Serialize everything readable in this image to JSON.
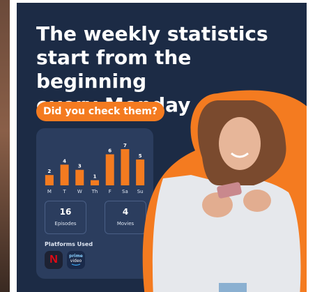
{
  "headline": "The weekly statistics\nstart from the beginning\nevery Monday",
  "cta_label": "Did you check them?",
  "chart_data": {
    "type": "bar",
    "categories": [
      "M",
      "T",
      "W",
      "Th",
      "F",
      "Sa",
      "Su"
    ],
    "values": [
      2,
      4,
      3,
      1,
      6,
      7,
      5
    ],
    "ylim": [
      0,
      7
    ],
    "bar_color": "#f47b20"
  },
  "stats": {
    "episodes": {
      "value": "16",
      "label": "Episodes"
    },
    "movies": {
      "value": "4",
      "label": "Movies"
    }
  },
  "platforms": {
    "label": "Platforms Used",
    "netflix_glyph": "N",
    "prime_top": "prime",
    "prime_bottom": "video"
  },
  "colors": {
    "background": "#1c2b45",
    "panel": "#2b3d5e",
    "accent": "#f47b20"
  }
}
